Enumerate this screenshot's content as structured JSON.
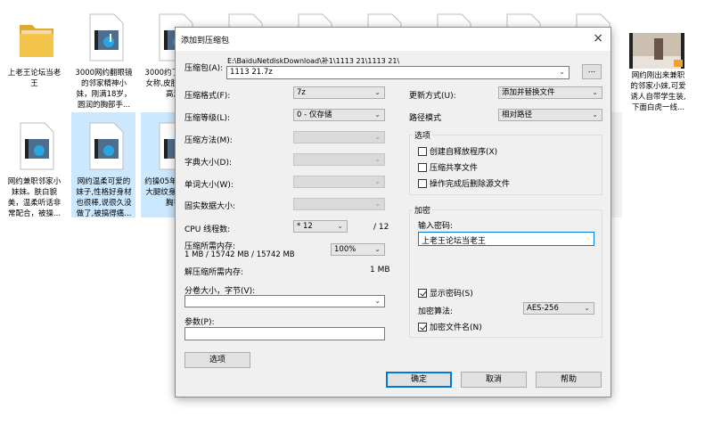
{
  "explorer": {
    "top_row": [
      {
        "label": "上老王论坛当老王",
        "kind": "folder"
      },
      {
        "label": "3000网约翻眼镜的邻家精神小妹，刚满18岁，圆润的胸部手...",
        "kind": "video"
      },
      {
        "label": "3000约了的小美女称,皮肤白干到高潮",
        "kind": "video"
      },
      {
        "label": "",
        "kind": "video"
      },
      {
        "label": "",
        "kind": "video"
      },
      {
        "label": "",
        "kind": "video"
      },
      {
        "label": "",
        "kind": "video"
      },
      {
        "label": "",
        "kind": "video"
      },
      {
        "label": "",
        "kind": "video"
      },
      {
        "label": "网约刚出来兼职的邻家小妹,可爱诱人自带学生装,下面白虎一线...",
        "kind": "thumb"
      }
    ],
    "bottom_row": [
      {
        "label": "网约兼职邻家小妹妹。肤白貌美，温柔听话非常配合，被操...",
        "kind": "video"
      },
      {
        "label": "网约温柔可爱的妹子,性格好身材也很棒,说很久没做了,被搞得痛...",
        "kind": "video"
      },
      {
        "label": "约操05年小美女,大腿纹身大质,小胸有",
        "kind": "video"
      }
    ]
  },
  "dialog": {
    "title": "添加到压缩包",
    "archive_label": "压缩包(A):",
    "archive_path": "E:\\BaiduNetdiskDownload\\补1\\1113 21\\1113 21\\",
    "archive_name": "1113 21.7z",
    "browse_label": "...",
    "format_label": "压缩格式(F):",
    "format_value": "7z",
    "level_label": "压缩等级(L):",
    "level_value": "0 - 仅存储",
    "method_label": "压缩方法(M):",
    "dict_label": "字典大小(D):",
    "word_label": "单词大小(W):",
    "solid_label": "固实数据大小:",
    "cpu_label": "CPU 线程数:",
    "cpu_value": "* 12",
    "cpu_max": "/ 12",
    "mem_comp_label": "压缩所需内存:",
    "mem_comp_value": "1 MB / 15742 MB / 15742 MB",
    "mem_percent": "100%",
    "mem_decomp_label": "解压缩所需内存:",
    "mem_decomp_value": "1 MB",
    "split_label": "分卷大小，字节(V):",
    "params_label": "参数(P):",
    "options_button": "选项",
    "update_label": "更新方式(U):",
    "update_value": "添加并替换文件",
    "path_mode_label": "路径模式",
    "path_mode_value": "相对路径",
    "options_group": "选项",
    "opt_sfx": "创建自释放程序(X)",
    "opt_shared": "压缩共享文件",
    "opt_delete": "操作完成后删除源文件",
    "encryption_group": "加密",
    "password_label": "输入密码:",
    "password_value": "上老王论坛当老王",
    "show_password": "显示密码(S)",
    "enc_method_label": "加密算法:",
    "enc_method_value": "AES-256",
    "encrypt_names": "加密文件名(N)",
    "ok": "确定",
    "cancel": "取消",
    "help": "帮助",
    "close_glyph": "×"
  },
  "colors": {
    "selection": "#cce8ff",
    "dialog_bg": "#f0f0f0",
    "focus_blue": "#0078d7",
    "folder_yellow": "#f3c54a"
  }
}
